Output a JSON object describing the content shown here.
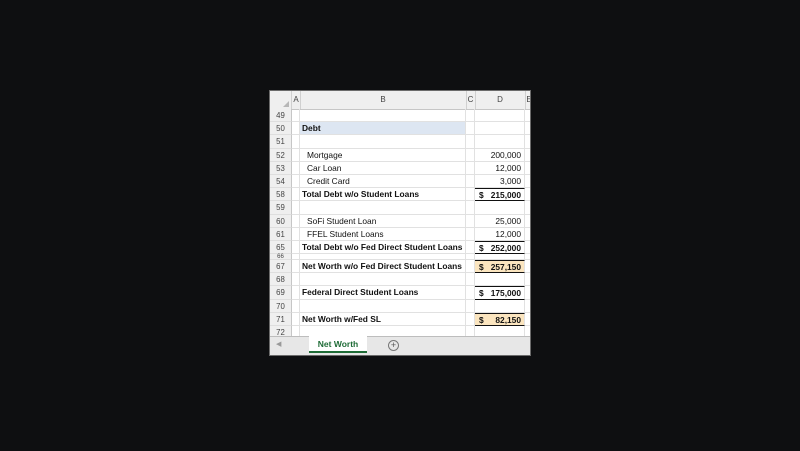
{
  "columns": [
    "A",
    "B",
    "C",
    "D",
    "E"
  ],
  "rows": [
    {
      "num": "49",
      "label": "",
      "value": "",
      "style": "plain"
    },
    {
      "num": "50",
      "label": "Debt",
      "value": "",
      "style": "header"
    },
    {
      "num": "51",
      "label": "",
      "value": "",
      "style": "plain"
    },
    {
      "num": "52",
      "label": "Mortgage",
      "value": "200,000",
      "style": "item"
    },
    {
      "num": "53",
      "label": "Car Loan",
      "value": "12,000",
      "style": "item"
    },
    {
      "num": "54",
      "label": "Credit Card",
      "value": "3,000",
      "style": "item"
    },
    {
      "num": "58",
      "label": "Total Debt w/o Student Loans",
      "currency": "$",
      "value": "215,000",
      "style": "total"
    },
    {
      "num": "59",
      "label": "",
      "value": "",
      "style": "plain"
    },
    {
      "num": "60",
      "label": "SoFi Student Loan",
      "value": "25,000",
      "style": "item"
    },
    {
      "num": "61",
      "label": "FFEL Student Loans",
      "value": "12,000",
      "style": "item"
    },
    {
      "num": "65",
      "label": "Total Debt w/o Fed Direct Student Loans",
      "currency": "$",
      "value": "252,000",
      "style": "total"
    },
    {
      "num": "66",
      "label": "",
      "value": "",
      "style": "thin"
    },
    {
      "num": "67",
      "label": "Net Worth w/o Fed Direct Student Loans",
      "currency": "$",
      "value": "257,150",
      "style": "highlight"
    },
    {
      "num": "68",
      "label": "",
      "value": "",
      "style": "plain"
    },
    {
      "num": "69",
      "label": "Federal Direct Student Loans",
      "currency": "$",
      "value": "175,000",
      "style": "total"
    },
    {
      "num": "70",
      "label": "",
      "value": "",
      "style": "plain"
    },
    {
      "num": "71",
      "label": "Net Worth w/Fed SL",
      "currency": "$",
      "value": "82,150",
      "style": "highlight"
    },
    {
      "num": "72",
      "label": "",
      "value": "",
      "style": "plain"
    }
  ],
  "tabs": {
    "active": "Net Worth",
    "add_label": "+"
  },
  "colors": {
    "debt_header_fill": "#dde6f2",
    "highlight_fill": "#fbe5bf",
    "tab_accent": "#1e6b36"
  }
}
